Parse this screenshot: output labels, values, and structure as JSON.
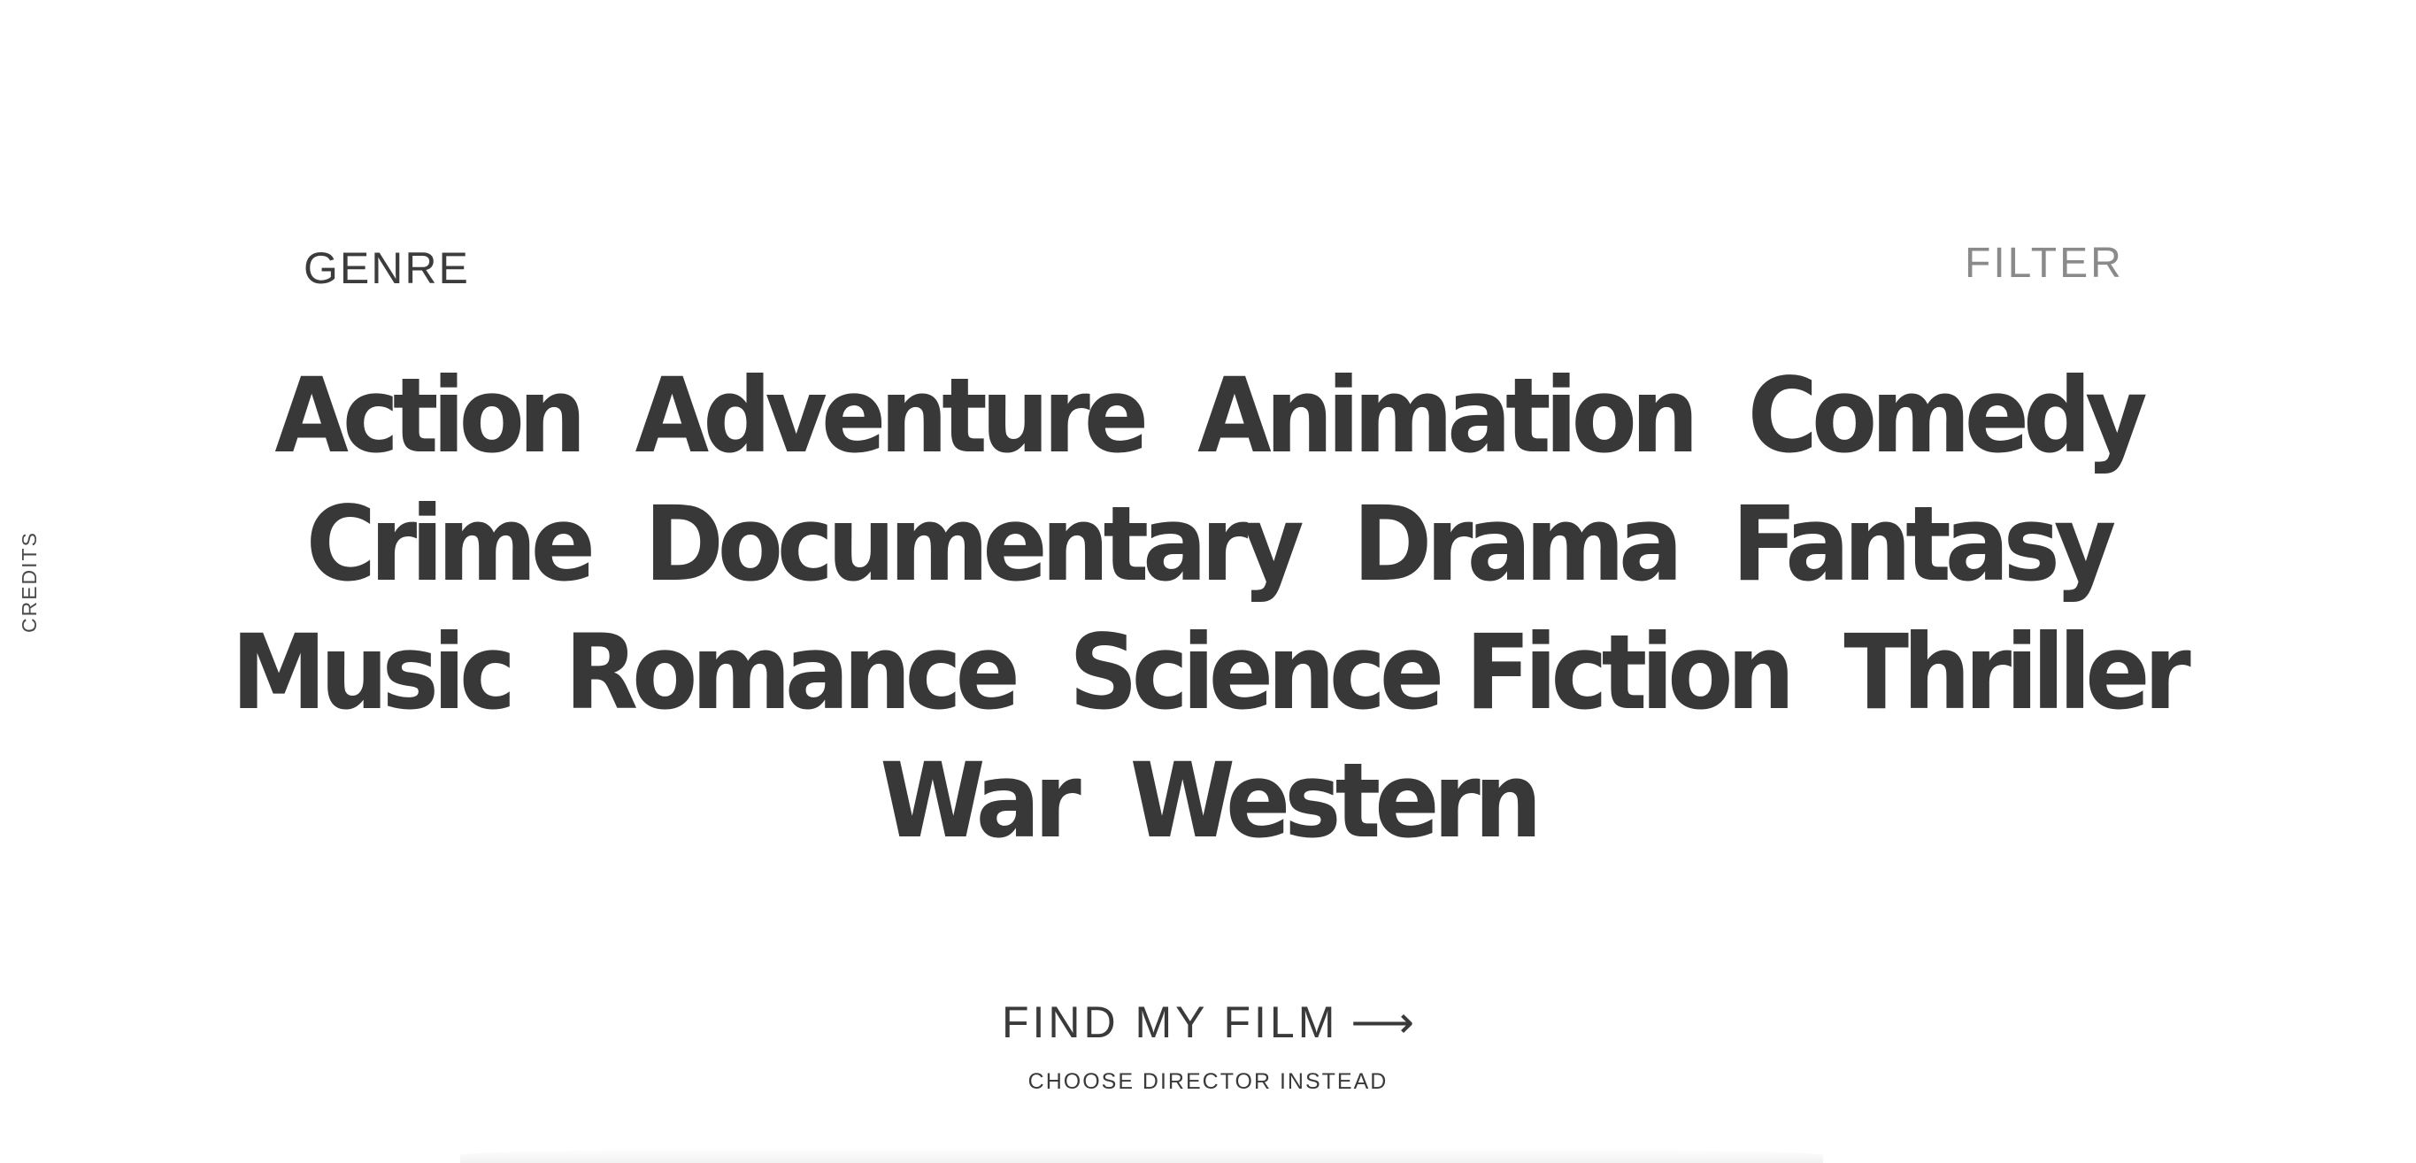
{
  "header": {
    "section_label": "GENRE",
    "filter_label": "FILTER"
  },
  "sidebar": {
    "credits_label": "CREDITS"
  },
  "genres": {
    "rows": [
      [
        "Action",
        "Adventure",
        "Animation",
        "Comedy"
      ],
      [
        "Crime",
        "Documentary",
        "Drama",
        "Fantasy"
      ],
      [
        "Music",
        "Romance",
        "Science Fiction",
        "Thriller"
      ],
      [
        "War",
        "Western"
      ]
    ]
  },
  "actions": {
    "find_label": "FIND MY FILM",
    "find_arrow": "⟶",
    "director_label": "CHOOSE DIRECTOR INSTEAD"
  },
  "colors": {
    "text": "#383838",
    "filter": "#8a8a8a",
    "background": "#ffffff"
  }
}
